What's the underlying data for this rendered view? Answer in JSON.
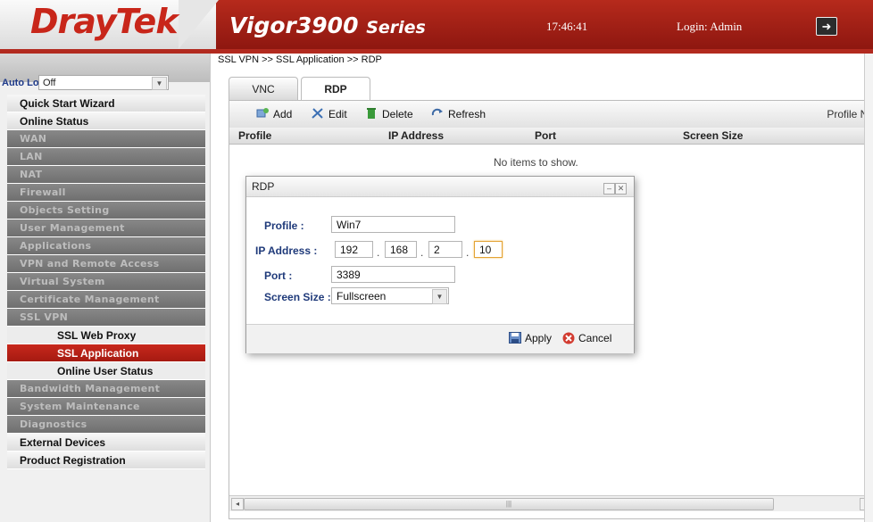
{
  "header": {
    "logo": "DrayTek",
    "series_main": "Vigor3900",
    "series_sub": "Series",
    "clock": "17:46:41",
    "login": "Login: Admin"
  },
  "colors": {
    "brand_red": "#b62a1c",
    "active_item": "#c8281c",
    "dark_menu": "#7a7a7a"
  },
  "sidebar": {
    "auto_logout_label": "Auto Logout",
    "auto_logout_value": "Off",
    "items": [
      {
        "label": "Quick Start Wizard"
      },
      {
        "label": "Online Status"
      },
      {
        "label": "WAN"
      },
      {
        "label": "LAN"
      },
      {
        "label": "NAT"
      },
      {
        "label": "Firewall"
      },
      {
        "label": "Objects Setting"
      },
      {
        "label": "User Management"
      },
      {
        "label": "Applications"
      },
      {
        "label": "VPN and Remote Access"
      },
      {
        "label": "Virtual System"
      },
      {
        "label": "Certificate Management"
      },
      {
        "label": "SSL VPN"
      },
      {
        "label": "SSL Web Proxy"
      },
      {
        "label": "SSL Application"
      },
      {
        "label": "Online User Status"
      },
      {
        "label": "Bandwidth Management"
      },
      {
        "label": "System Maintenance"
      },
      {
        "label": "Diagnostics"
      },
      {
        "label": "External Devices"
      },
      {
        "label": "Product Registration"
      }
    ]
  },
  "main": {
    "breadcrumb": "SSL VPN >> SSL Application >> RDP",
    "tabs": [
      {
        "label": "VNC"
      },
      {
        "label": "RDP"
      }
    ],
    "toolbar": {
      "add": "Add",
      "edit": "Edit",
      "delete": "Delete",
      "refresh": "Refresh",
      "profile_number": "Profile Nu"
    },
    "columns": [
      "Profile",
      "IP Address",
      "Port",
      "Screen Size"
    ],
    "empty_text": "No items to show."
  },
  "dialog": {
    "title": "RDP",
    "profile_label": "Profile :",
    "profile_value": "Win7",
    "ip_label": "IP Address :",
    "ip": [
      "192",
      "168",
      "2",
      "10"
    ],
    "port_label": "Port :",
    "port_value": "3389",
    "screen_label": "Screen Size :",
    "screen_value": "Fullscreen",
    "apply": "Apply",
    "cancel": "Cancel"
  }
}
